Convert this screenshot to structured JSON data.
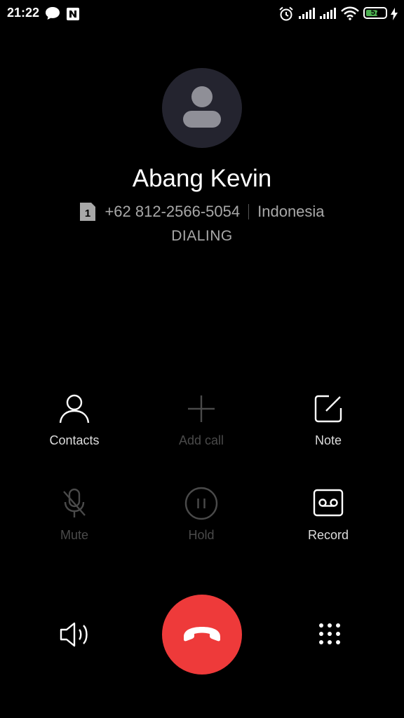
{
  "status_bar": {
    "time": "21:22",
    "battery_level": "57",
    "icons": [
      "chat-bubble-icon",
      "n-notification-icon",
      "alarm-icon",
      "signal-icon",
      "signal-icon",
      "wifi-icon",
      "battery-icon",
      "charging-icon"
    ]
  },
  "caller": {
    "name": "Abang Kevin",
    "sim_slot": "1",
    "number": "+62 812-2566-5054",
    "location": "Indonesia",
    "status": "DIALING"
  },
  "actions": {
    "contacts": {
      "label": "Contacts",
      "icon": "person-icon",
      "enabled": true
    },
    "add_call": {
      "label": "Add call",
      "icon": "plus-icon",
      "enabled": false
    },
    "note": {
      "label": "Note",
      "icon": "note-edit-icon",
      "enabled": true
    },
    "mute": {
      "label": "Mute",
      "icon": "mic-off-icon",
      "enabled": false
    },
    "hold": {
      "label": "Hold",
      "icon": "pause-icon",
      "enabled": false
    },
    "record": {
      "label": "Record",
      "icon": "record-tape-icon",
      "enabled": true
    }
  },
  "bottom": {
    "speaker_icon": "speaker-icon",
    "end_call_icon": "hang-up-phone-icon",
    "dialpad_icon": "dialpad-icon"
  },
  "colors": {
    "background": "#000000",
    "end_call": "#ee3a3a",
    "avatar_bg": "#24242f",
    "battery": "#4caf50"
  }
}
